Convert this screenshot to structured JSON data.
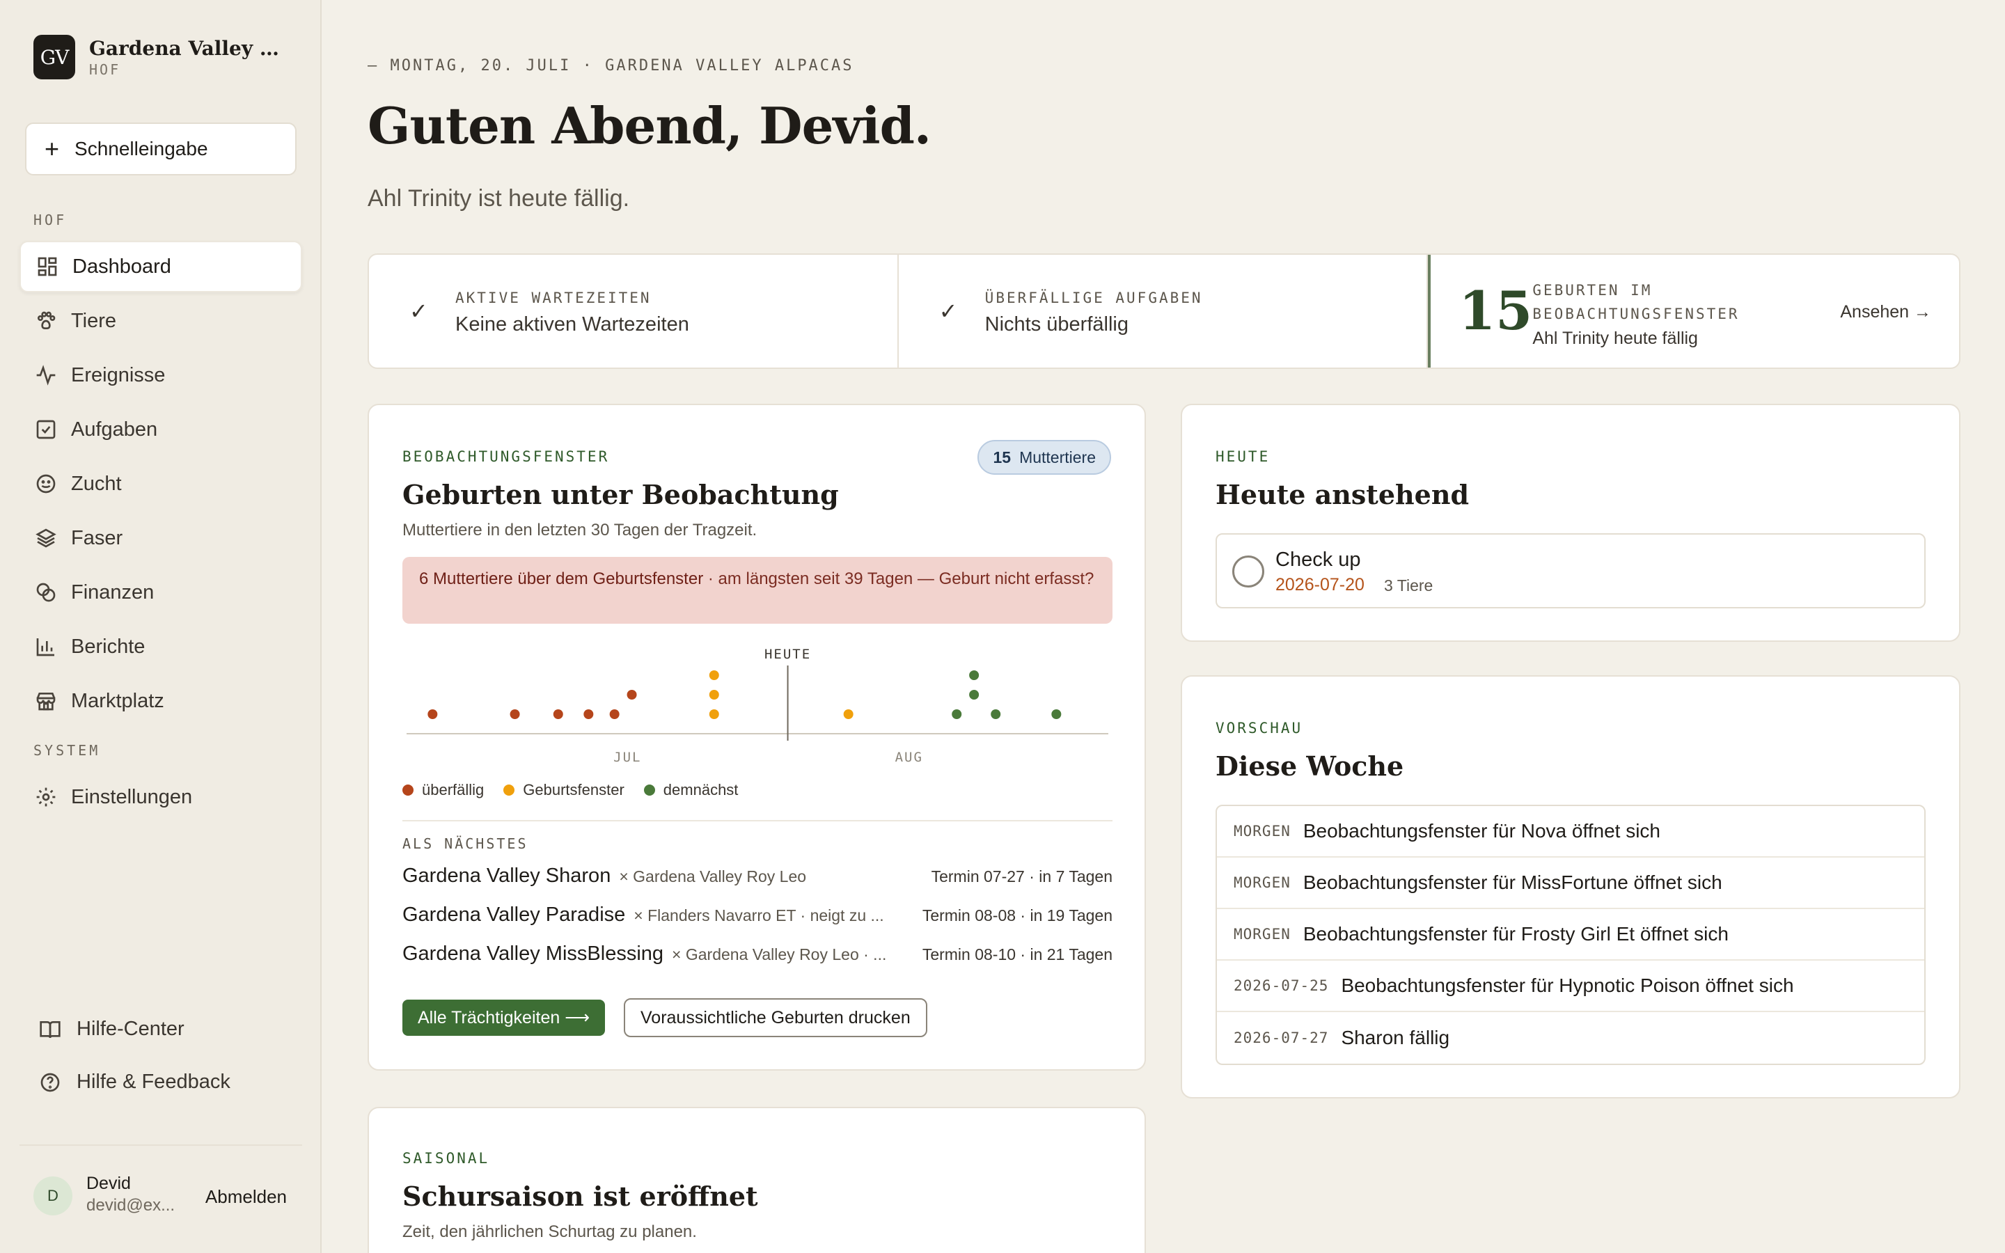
{
  "brand": {
    "logo": "GV",
    "name": "Gardena Valley Alp...",
    "sub": "HOF"
  },
  "quick_entry": {
    "label": "Schnelleingabe",
    "icon": "plus-icon"
  },
  "sidebar": {
    "section_hof": "HOF",
    "items": [
      {
        "label": "Dashboard",
        "icon": "dashboard-icon",
        "active": true
      },
      {
        "label": "Tiere",
        "icon": "paw-icon"
      },
      {
        "label": "Ereignisse",
        "icon": "activity-icon"
      },
      {
        "label": "Aufgaben",
        "icon": "checkbox-icon"
      },
      {
        "label": "Zucht",
        "icon": "smile-icon"
      },
      {
        "label": "Faser",
        "icon": "layers-icon"
      },
      {
        "label": "Finanzen",
        "icon": "coins-icon"
      },
      {
        "label": "Berichte",
        "icon": "bar-chart-icon"
      },
      {
        "label": "Marktplatz",
        "icon": "store-icon"
      }
    ],
    "section_system": "SYSTEM",
    "settings": {
      "label": "Einstellungen",
      "icon": "gear-icon"
    },
    "help_center": {
      "label": "Hilfe-Center",
      "icon": "book-icon"
    },
    "help_feedback": {
      "label": "Hilfe & Feedback",
      "icon": "help-circle-icon"
    }
  },
  "user": {
    "initial": "D",
    "name": "Devid",
    "email": "devid@ex...",
    "logout": "Abmelden"
  },
  "header": {
    "date_line": "— MONTAG, 20. JULI · GARDENA VALLEY ALPACAS",
    "greeting": "Guten Abend, Devid.",
    "subtitle": "Ahl Trinity ist heute fällig."
  },
  "stats": {
    "waits": {
      "check": "✓",
      "label": "AKTIVE WARTEZEITEN",
      "value": "Keine aktiven Wartezeiten"
    },
    "overdue": {
      "check": "✓",
      "label": "ÜBERFÄLLIGE AUFGABEN",
      "value": "Nichts überfällig"
    },
    "births": {
      "number": "15",
      "label": "GEBURTEN IM BEOBACHTUNGSFENSTER",
      "value": "Ahl Trinity heute fällig",
      "link": "Ansehen →"
    }
  },
  "observation": {
    "eyebrow": "BEOBACHTUNGSFENSTER",
    "title": "Geburten unter Beobachtung",
    "subtitle": "Muttertiere in den letzten 30 Tagen der Tragzeit.",
    "pill_count": "15",
    "pill_label": "Muttertiere",
    "alert_bold": "6 Muttertiere über dem Geburtsfenster",
    "alert_rest": " · am längsten seit 39 Tagen — Geburt nicht erfasst?",
    "chart_today": "HEUTE",
    "chart_month_1": "JUL",
    "chart_month_2": "AUG",
    "legend": [
      {
        "label": "überfällig",
        "color": "#b5451b"
      },
      {
        "label": "Geburtsfenster",
        "color": "#f0a00c"
      },
      {
        "label": "demnächst",
        "color": "#4a7a3a"
      }
    ],
    "next_label": "ALS NÄCHSTES",
    "next": [
      {
        "name": "Gardena Valley Sharon",
        "mate": "× Gardena Valley Roy Leo",
        "term": "Termin 07-27 · in 7 Tagen"
      },
      {
        "name": "Gardena Valley Paradise",
        "mate": "× Flanders Navarro ET  · neigt zu ...",
        "term": "Termin 08-08 · in 19 Tagen"
      },
      {
        "name": "Gardena Valley MissBlessing",
        "mate": "× Gardena Valley Roy Leo  · ...",
        "term": "Termin 08-10 · in 21 Tagen"
      }
    ],
    "btn_all": "Alle Trächtigkeiten ⟶",
    "btn_print": "Voraussichtliche Geburten drucken"
  },
  "today": {
    "eyebrow": "HEUTE",
    "title": "Heute anstehend",
    "task_name": "Check up",
    "task_date": "2026-07-20",
    "task_count": "3 Tiere"
  },
  "week": {
    "eyebrow": "VORSCHAU",
    "title": "Diese Woche",
    "rows": [
      {
        "when": "MORGEN",
        "text": "Beobachtungsfenster für Nova öffnet sich"
      },
      {
        "when": "MORGEN",
        "text": "Beobachtungsfenster für MissFortune öffnet sich"
      },
      {
        "when": "MORGEN",
        "text": "Beobachtungsfenster für Frosty Girl Et öffnet sich"
      },
      {
        "when": "2026-07-25",
        "text": "Beobachtungsfenster für Hypnotic Poison öffnet sich"
      },
      {
        "when": "2026-07-27",
        "text": "Sharon fällig"
      }
    ]
  },
  "seasonal": {
    "eyebrow": "SAISONAL",
    "title": "Schursaison ist eröffnet",
    "subtitle": "Zeit, den jährlichen Schurtag zu planen."
  },
  "chart_data": {
    "type": "scatter",
    "x_unit": "days relative to today",
    "today_label": "HEUTE",
    "xlim": [
      -44,
      37
    ],
    "x_ticks": [
      {
        "x": -18.5,
        "label": "JUL"
      },
      {
        "x": 14,
        "label": "AUG"
      }
    ],
    "points": [
      {
        "x": -41,
        "stack": 0,
        "status": "überfällig"
      },
      {
        "x": -31.5,
        "stack": 0,
        "status": "überfällig"
      },
      {
        "x": -26.5,
        "stack": 0,
        "status": "überfällig"
      },
      {
        "x": -23,
        "stack": 0,
        "status": "überfällig"
      },
      {
        "x": -20,
        "stack": 0,
        "status": "überfällig"
      },
      {
        "x": -18,
        "stack": 1,
        "status": "überfällig"
      },
      {
        "x": -8.5,
        "stack": 0,
        "status": "Geburtsfenster"
      },
      {
        "x": -8.5,
        "stack": 1,
        "status": "Geburtsfenster"
      },
      {
        "x": -8.5,
        "stack": 2,
        "status": "Geburtsfenster"
      },
      {
        "x": 7,
        "stack": 0,
        "status": "Geburtsfenster"
      },
      {
        "x": 19.5,
        "stack": 0,
        "status": "demnächst"
      },
      {
        "x": 21.5,
        "stack": 1,
        "status": "demnächst"
      },
      {
        "x": 21.5,
        "stack": 2,
        "status": "demnächst"
      },
      {
        "x": 24,
        "stack": 0,
        "status": "demnächst"
      },
      {
        "x": 31,
        "stack": 0,
        "status": "demnächst"
      }
    ]
  }
}
